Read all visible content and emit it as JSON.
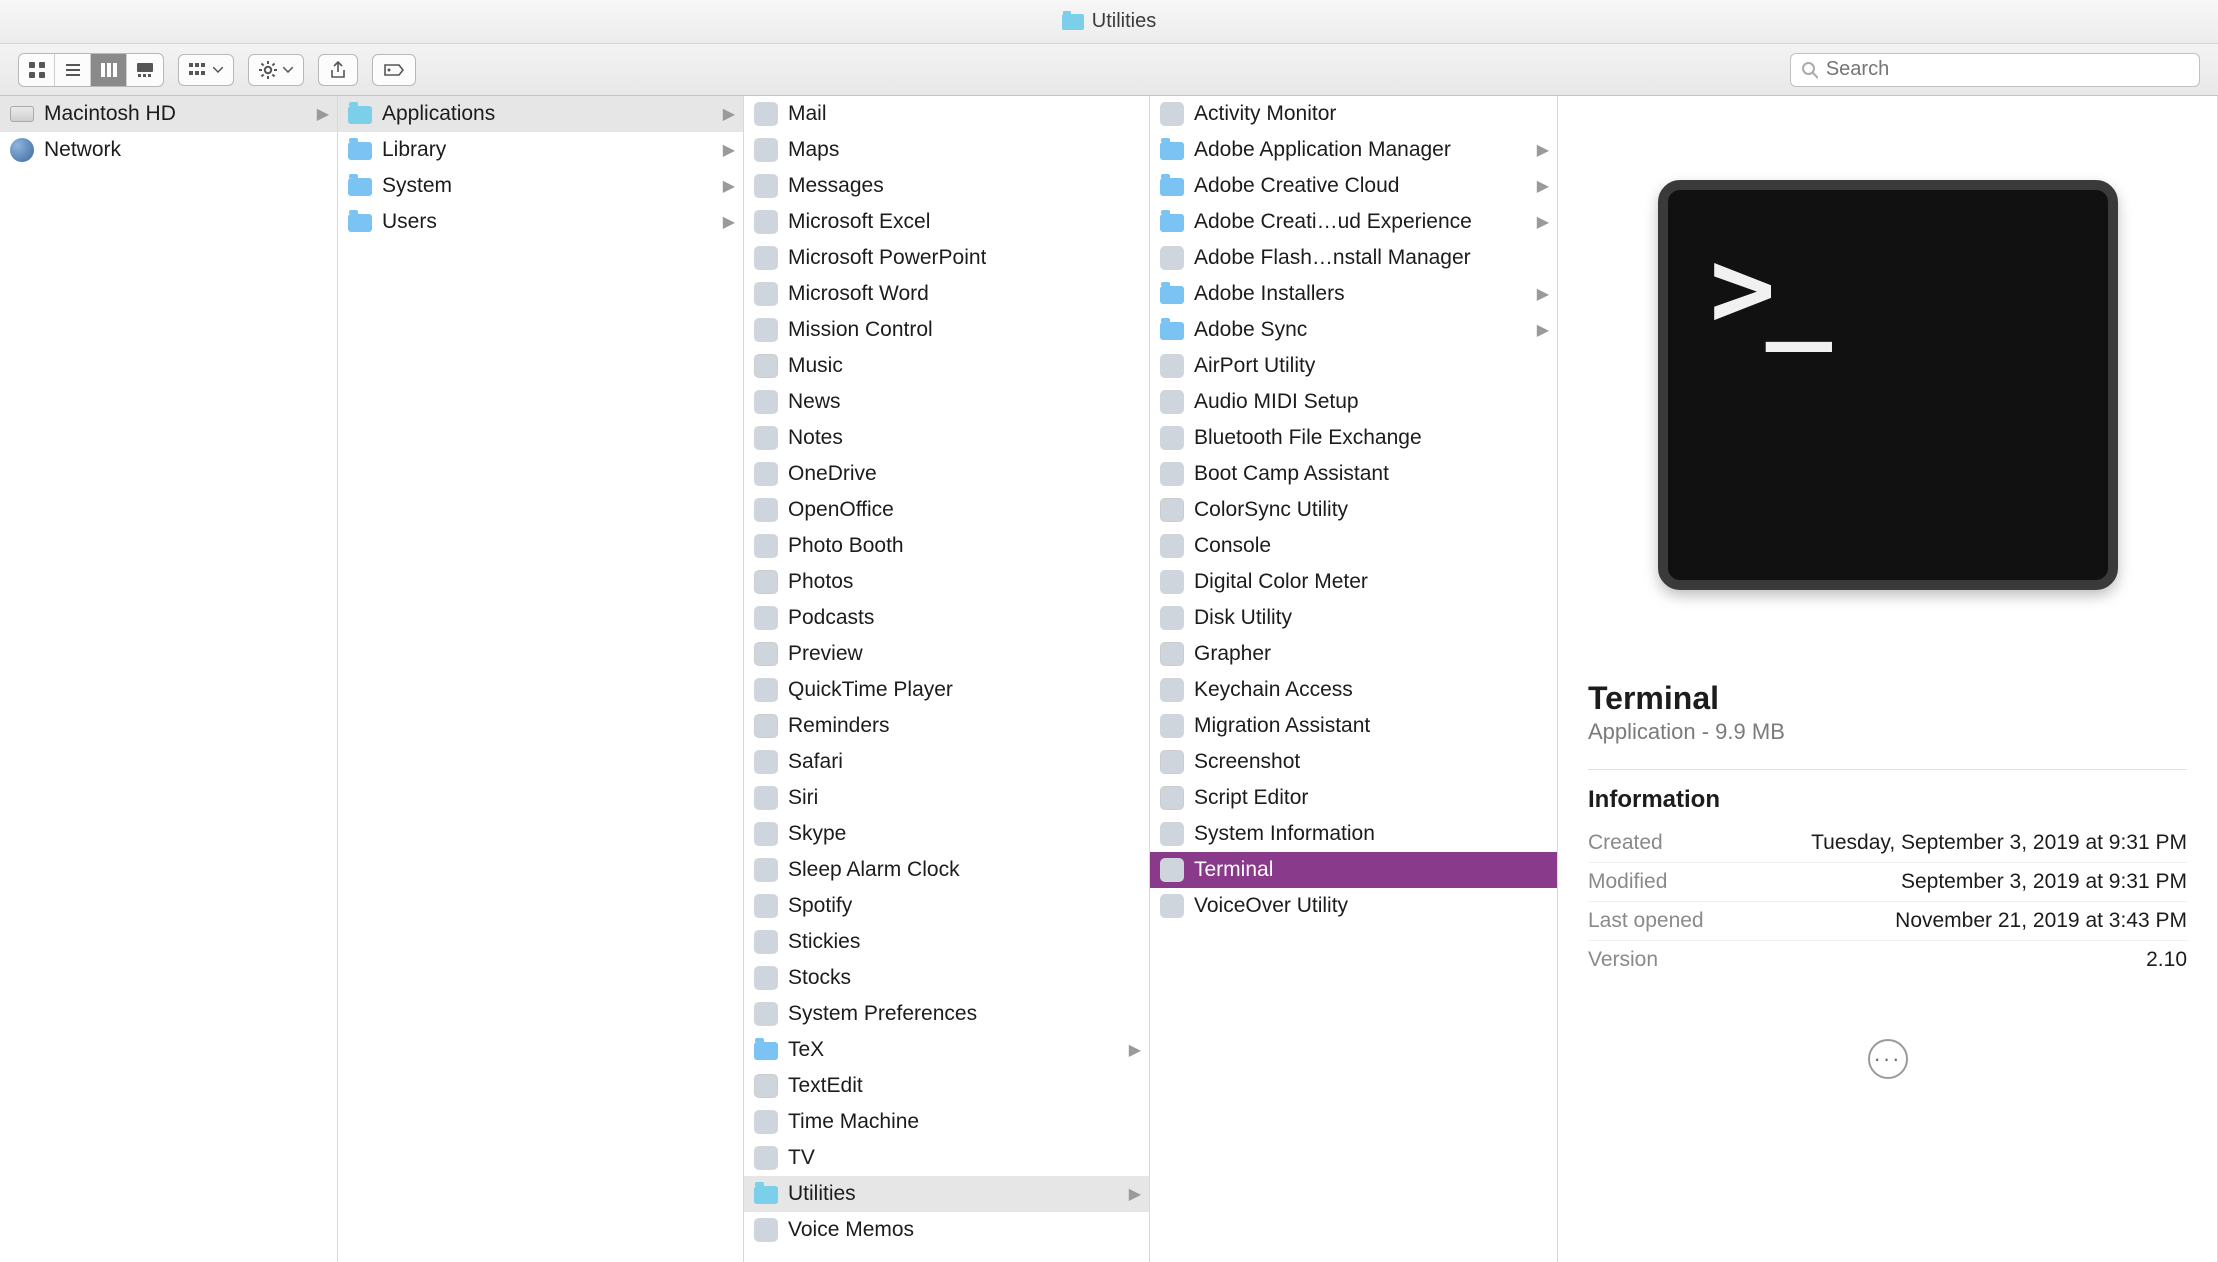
{
  "window": {
    "title": "Utilities"
  },
  "toolbar": {
    "view_modes": [
      "icon",
      "list",
      "column",
      "gallery"
    ],
    "active_view_mode": "column",
    "search_placeholder": "Search"
  },
  "columns": {
    "col0": [
      {
        "label": "Macintosh HD",
        "icon": "hdd",
        "has_children": true,
        "selected_path": true
      },
      {
        "label": "Network",
        "icon": "globe",
        "has_children": false
      }
    ],
    "col1": [
      {
        "label": "Applications",
        "icon": "folder-teal",
        "has_children": true,
        "selected_path": true
      },
      {
        "label": "Library",
        "icon": "folder",
        "has_children": true
      },
      {
        "label": "System",
        "icon": "folder",
        "has_children": true
      },
      {
        "label": "Users",
        "icon": "folder",
        "has_children": true
      }
    ],
    "col2": [
      {
        "label": "Mail",
        "icon": "app",
        "color": "c-blue"
      },
      {
        "label": "Maps",
        "icon": "app",
        "color": "c-teal"
      },
      {
        "label": "Messages",
        "icon": "app",
        "color": "c-cyan"
      },
      {
        "label": "Microsoft Excel",
        "icon": "app",
        "color": "c-green"
      },
      {
        "label": "Microsoft PowerPoint",
        "icon": "app",
        "color": "c-orange"
      },
      {
        "label": "Microsoft Word",
        "icon": "app",
        "color": "c-blue"
      },
      {
        "label": "Mission Control",
        "icon": "app",
        "color": "c-gray"
      },
      {
        "label": "Music",
        "icon": "app",
        "color": "c-white"
      },
      {
        "label": "News",
        "icon": "app",
        "color": "c-red"
      },
      {
        "label": "Notes",
        "icon": "app",
        "color": "c-yellow"
      },
      {
        "label": "OneDrive",
        "icon": "app",
        "color": "c-blue"
      },
      {
        "label": "OpenOffice",
        "icon": "app",
        "color": "c-teal"
      },
      {
        "label": "Photo Booth",
        "icon": "app",
        "color": "c-pink"
      },
      {
        "label": "Photos",
        "icon": "app",
        "color": "c-white"
      },
      {
        "label": "Podcasts",
        "icon": "app",
        "color": "c-purple"
      },
      {
        "label": "Preview",
        "icon": "app",
        "color": "c-white"
      },
      {
        "label": "QuickTime Player",
        "icon": "app",
        "color": "c-gray"
      },
      {
        "label": "Reminders",
        "icon": "app",
        "color": "c-white"
      },
      {
        "label": "Safari",
        "icon": "app",
        "color": "c-blue"
      },
      {
        "label": "Siri",
        "icon": "app",
        "color": "c-black"
      },
      {
        "label": "Skype",
        "icon": "app",
        "color": "c-cyan"
      },
      {
        "label": "Sleep Alarm Clock",
        "icon": "app",
        "color": "c-black"
      },
      {
        "label": "Spotify",
        "icon": "app",
        "color": "c-green"
      },
      {
        "label": "Stickies",
        "icon": "app",
        "color": "c-yellow"
      },
      {
        "label": "Stocks",
        "icon": "app",
        "color": "c-black"
      },
      {
        "label": "System Preferences",
        "icon": "app",
        "color": "c-gray"
      },
      {
        "label": "TeX",
        "icon": "folder",
        "has_children": true
      },
      {
        "label": "TextEdit",
        "icon": "app",
        "color": "c-white"
      },
      {
        "label": "Time Machine",
        "icon": "app",
        "color": "c-teal"
      },
      {
        "label": "TV",
        "icon": "app",
        "color": "c-black"
      },
      {
        "label": "Utilities",
        "icon": "folder-teal",
        "has_children": true,
        "selected_path": true
      },
      {
        "label": "Voice Memos",
        "icon": "app",
        "color": "c-red"
      }
    ],
    "col3": [
      {
        "label": "Activity Monitor",
        "icon": "app",
        "color": "c-black"
      },
      {
        "label": "Adobe Application Manager",
        "icon": "folder",
        "has_children": true
      },
      {
        "label": "Adobe Creative Cloud",
        "icon": "folder",
        "has_children": true
      },
      {
        "label": "Adobe Creati…ud Experience",
        "icon": "folder",
        "has_children": true
      },
      {
        "label": "Adobe Flash…nstall Manager",
        "icon": "app",
        "color": "c-red"
      },
      {
        "label": "Adobe Installers",
        "icon": "folder",
        "has_children": true
      },
      {
        "label": "Adobe Sync",
        "icon": "folder",
        "has_children": true
      },
      {
        "label": "AirPort Utility",
        "icon": "app",
        "color": "c-cyan"
      },
      {
        "label": "Audio MIDI Setup",
        "icon": "app",
        "color": "c-gray"
      },
      {
        "label": "Bluetooth File Exchange",
        "icon": "app",
        "color": "c-blue"
      },
      {
        "label": "Boot Camp Assistant",
        "icon": "app",
        "color": "c-gray"
      },
      {
        "label": "ColorSync Utility",
        "icon": "app",
        "color": "c-white"
      },
      {
        "label": "Console",
        "icon": "app",
        "color": "c-black"
      },
      {
        "label": "Digital Color Meter",
        "icon": "app",
        "color": "c-gray"
      },
      {
        "label": "Disk Utility",
        "icon": "app",
        "color": "c-gray"
      },
      {
        "label": "Grapher",
        "icon": "app",
        "color": "c-white"
      },
      {
        "label": "Keychain Access",
        "icon": "app",
        "color": "c-gray"
      },
      {
        "label": "Migration Assistant",
        "icon": "app",
        "color": "c-gray"
      },
      {
        "label": "Screenshot",
        "icon": "app",
        "color": "c-white"
      },
      {
        "label": "Script Editor",
        "icon": "app",
        "color": "c-white"
      },
      {
        "label": "System Information",
        "icon": "app",
        "color": "c-blue"
      },
      {
        "label": "Terminal",
        "icon": "app",
        "color": "c-black",
        "selected_active": true
      },
      {
        "label": "VoiceOver Utility",
        "icon": "app",
        "color": "c-gray"
      }
    ]
  },
  "info": {
    "name": "Terminal",
    "kind_size": "Application - 9.9 MB",
    "section_label": "Information",
    "created_label": "Created",
    "created_value": "Tuesday, September 3, 2019 at 9:31 PM",
    "modified_label": "Modified",
    "modified_value": "September 3, 2019 at 9:31 PM",
    "opened_label": "Last opened",
    "opened_value": "November 21, 2019 at 3:43 PM",
    "version_label": "Version",
    "version_value": "2.10"
  }
}
